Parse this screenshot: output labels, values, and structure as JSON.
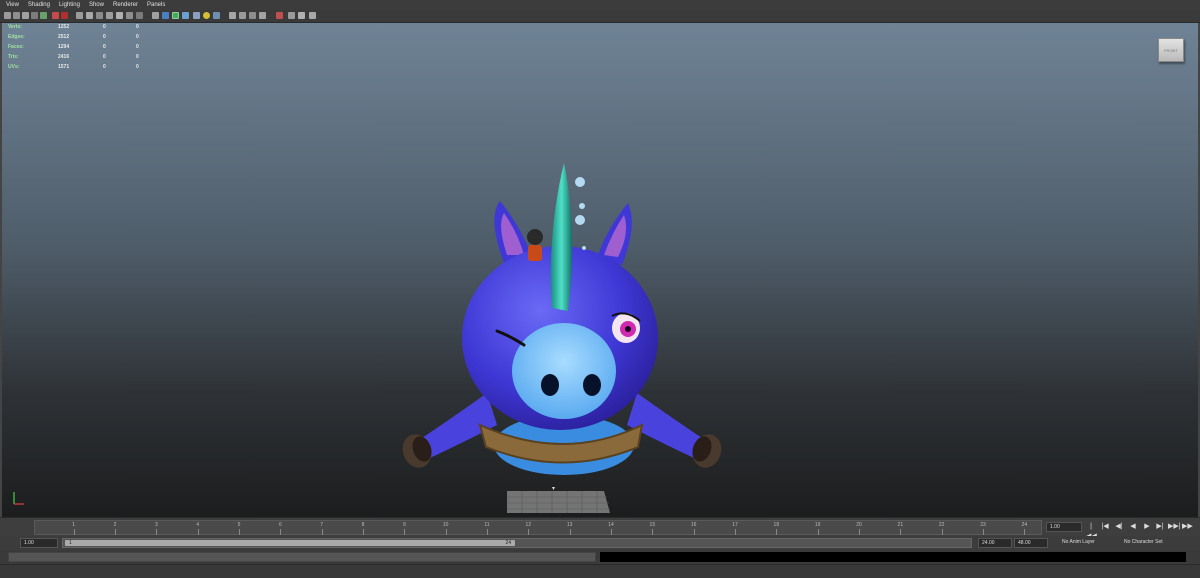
{
  "menubar": {
    "items": [
      "View",
      "Shading",
      "Lighting",
      "Show",
      "Renderer",
      "Panels"
    ]
  },
  "hud": {
    "rows": [
      {
        "label": "Verts:",
        "v0": "1252",
        "v1": "0",
        "v2": "0"
      },
      {
        "label": "Edges:",
        "v0": "2512",
        "v1": "0",
        "v2": "0"
      },
      {
        "label": "Faces:",
        "v0": "1294",
        "v1": "0",
        "v2": "0"
      },
      {
        "label": "Tris:",
        "v0": "2416",
        "v1": "0",
        "v2": "0"
      },
      {
        "label": "UVs:",
        "v0": "1571",
        "v1": "0",
        "v2": "0"
      }
    ]
  },
  "viewcube": {
    "label": "FRONT"
  },
  "timeline": {
    "ticks": [
      "1",
      "2",
      "3",
      "4",
      "5",
      "6",
      "7",
      "8",
      "9",
      "10",
      "11",
      "12",
      "13",
      "14",
      "15",
      "16",
      "17",
      "18",
      "19",
      "20",
      "21",
      "22",
      "23",
      "24"
    ],
    "current_frame": "1.00",
    "playback": [
      "|◀◀",
      "|◀",
      "◀|",
      "◀",
      "▶",
      "▶|",
      "▶▶|",
      "▶▶"
    ]
  },
  "range": {
    "start": "1.00",
    "range_start": "1",
    "range_end": "24",
    "end": "24.00",
    "anim_end": "48.00",
    "anim_layer": "No Anim Layer",
    "character_set": "No Character Set"
  },
  "colors": {
    "viewport_top": "#6f8396",
    "viewport_bottom": "#1c1d1e",
    "hud_label": "#9fe39f",
    "character_body": "#4a3fd8"
  }
}
